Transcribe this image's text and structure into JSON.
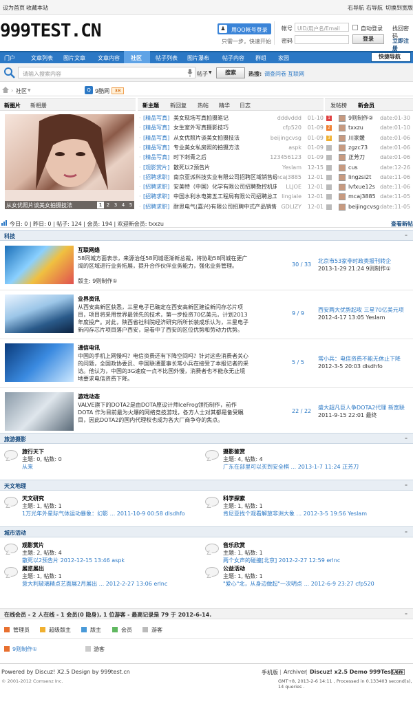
{
  "topbar": {
    "set_home": "设为首页",
    "bookmark": "收藏本站",
    "right_nav": "右导航",
    "right_nav2": "右导航",
    "wide_switch": "切换到宽版"
  },
  "logo": "999TEST.CN",
  "login": {
    "qq_button": "用QQ帐号登录",
    "qq_sub": "只需一步，快速开始",
    "account_label": "帐号",
    "account_placeholder": "UID/用户名/Email",
    "auto_login": "自动登录",
    "find_password": "找回密码",
    "password_label": "密码",
    "login_button": "登录",
    "register": "立即注册"
  },
  "nav": {
    "items": [
      "门户",
      "文章列表",
      "图片文章",
      "文章内容",
      "社区",
      "帖子列表",
      "图片瀑布",
      "帖子内容",
      "群组",
      "家园"
    ],
    "active": "社区",
    "quick_nav": "快捷导航"
  },
  "search": {
    "placeholder": "请输入搜索内容",
    "type": "帖子",
    "button": "搜索",
    "hot_label": "热搜:",
    "hot": [
      "调查问卷",
      "互联网"
    ]
  },
  "breadcrumb": {
    "home_icon": "home-icon",
    "community": "社区",
    "site": "9酷网",
    "count": "38"
  },
  "tabs_left": [
    "新图片",
    "新相册"
  ],
  "image_caption": "从女优照片谈美女拍摄技法",
  "image_pages": [
    "1",
    "2",
    "3",
    "4",
    "5"
  ],
  "tabs_mid": [
    "新主题",
    "新回复",
    "热帖",
    "精华",
    "日志"
  ],
  "tabs_right": [
    "发帖榜",
    "新会员"
  ],
  "threads": [
    {
      "cat": "[精品写真]",
      "title": "美女现场写真拍摄笔记",
      "author": "dddvddd",
      "date": "01-10"
    },
    {
      "cat": "[精品写真]",
      "title": "女生室外写真摄影技巧",
      "author": "cfp520",
      "date": "01-09"
    },
    {
      "cat": "[精品写真]",
      "title": "从女优照片谈美女拍摄技法",
      "author": "beijingcvsg",
      "date": "01-09"
    },
    {
      "cat": "[精品写真]",
      "title": "专业美女私房照的拍摄方法",
      "author": "aspk",
      "date": "01-09"
    },
    {
      "cat": "[精品写真]",
      "title": "时下刺青之后",
      "author": "123456123",
      "date": "01-09"
    },
    {
      "cat": "[观影赏片]",
      "title": "散死以2预告片",
      "author": "Yeslam",
      "date": "12-15"
    },
    {
      "cat": "[招聘求职]",
      "title": "南京亚派科技实业有限公司招聘区域销售经理",
      "author": "mcaj3885",
      "date": "12-01"
    },
    {
      "cat": "[招聘求职]",
      "title": "安美特（中国）化学有限公司招聘数控机床操",
      "author": "LLJOE",
      "date": "12-01"
    },
    {
      "cat": "[招聘求职]",
      "title": "中国水利水电第五工程局有限公司招聘总工程",
      "author": "lingiale",
      "date": "12-01"
    },
    {
      "cat": "[招聘求职]",
      "title": "耐思电气(嘉兴)有限公司招聘中式产品销售代",
      "author": "GDLIZY",
      "date": "12-01"
    }
  ],
  "members": [
    {
      "rank": "1",
      "name": "9则制作②",
      "date": "date:01-30"
    },
    {
      "rank": "2",
      "name": "txxzu",
      "date": "date:01-10"
    },
    {
      "rank": "3",
      "name": "川家媛",
      "date": "date:01-06"
    },
    {
      "rank": "",
      "name": "zgzc73",
      "date": "date:01-06"
    },
    {
      "rank": "",
      "name": "正芳刀",
      "date": "date:01-06"
    },
    {
      "rank": "",
      "name": "cus",
      "date": "date:12-26"
    },
    {
      "rank": "",
      "name": "lingzsi2t",
      "date": "date:11-06"
    },
    {
      "rank": "",
      "name": "lvfxue12s",
      "date": "date:11-06"
    },
    {
      "rank": "",
      "name": "mcaj3885",
      "date": "date:11-05"
    },
    {
      "rank": "",
      "name": "beijingcvsg",
      "date": "date:11-05"
    }
  ],
  "stats": {
    "text": "今日: 0  |  昨日: 0  |  帖子: 124  |  会员: 194  |  欢迎新会员: txxzu",
    "new_posts": "查看新帖"
  },
  "sections": [
    {
      "title": "科技",
      "forums": [
        {
          "name": "互联网络",
          "desc": "58同城方面表示，来源治任58同城逐渐新总裁，将协助58同城在更广阔的区域进行业务拓展，提升合作伙伴业务能力，强化业务管理。",
          "mods": "版主: 9则制作①",
          "count": "30 / 33",
          "last": "北京市53家非时政类报刊转企",
          "last_by": "2013-1-29 21:24  9则制作①"
        },
        {
          "name": "业界资讯",
          "desc": "从西安高新区获悉，三星电子已确定在西安高新区建设新闪存芯片项目，项目将采用世界最领先的技术，第一步投资70亿美元，计划2013年度投产。对此，陕西省社科院经济研究所所长装成乐认为，三星电子新闪存芯片项目落户西安，是看中了西安的区位优势和劳动力优势。",
          "mods": "",
          "count": "9 / 9",
          "last": "西安两大优势起攻 三星70亿美元项",
          "last_by": "2012-4-17 13:05  Yeslam"
        },
        {
          "name": "通信电讯",
          "desc": "中国的手机上网慢吗？电信资费还有下降空间吗？针对这些消费者关心的问题，全国政协委员、中国联通董事长常小兵在接受了本报记者的采访。他认为，中国的3G速度一点不比国外慢，消费者也不能永无止境地要求电信资费下降。",
          "mods": "",
          "count": "5 / 5",
          "last": "常小兵：电信资费不能无休止下降",
          "last_by": "2012-3-5 20:03  dlsdhfo"
        },
        {
          "name": "游戏动态",
          "desc": "VALVE旗下的DOTA2是由DOTA原设计师IceFrog领衔制作，前作 DOTA 作为目前最为火爆的网络竞技游戏，各方人士对其都是备受瞩目，因此DOTA2的国内代理权也成为各大厂商争夺的焦点。",
          "mods": "",
          "count": "22 / 22",
          "last": "盛大超凡巨人争DOTA2代理 新宽联",
          "last_by": "2011-9-15 22:01  最终"
        }
      ]
    },
    {
      "title": "旅游摄影",
      "forums": [
        {
          "name": "旅行天下",
          "stats": "主题: 0, 帖数: 0",
          "last": "从来"
        },
        {
          "name": "摄影鉴赏",
          "stats": "主题: 4, 帖数: 4",
          "last": "广东在部里可以买到安全棋 ... 2013-1-7 11:24 正芳刀"
        }
      ]
    },
    {
      "title": "天文地理",
      "forums": [
        {
          "name": "天文研究",
          "stats": "主题: 1, 帖数: 1",
          "last": "1万光年外星际气体运动暴象：幻影 ... 2011-10-9 00:58 dlsdhfo"
        },
        {
          "name": "科学探索",
          "stats": "主题: 1, 帖数: 1",
          "last": "肯尼亚找个观看解放非洲大象 ... 2012-3-5 19:56 Yeslam"
        }
      ]
    },
    {
      "title": "城市活动",
      "forums": [
        {
          "name": "观影赏片",
          "stats": "主题: 2, 帖数: 4",
          "last": "散死以2预告片 2012-12-15 13:46 aspk"
        },
        {
          "name": "音乐欣赏",
          "stats": "主题: 1, 帖数: 1",
          "last": "两个女声的碰撞[北京] 2012-2-27 12:59 erlnc"
        },
        {
          "name": "展览展出",
          "stats": "主题: 1, 帖数: 1",
          "last": "意大利玻璃精点艺面展2月展出 ... 2012-2-27 13:06 erlnc"
        },
        {
          "name": "公益活动",
          "stats": "主题: 1, 帖数: 1",
          "last": "\"爱心\"北，从身边做起\"一次明点 ... 2012-6-9 23:27 cfp520"
        }
      ]
    }
  ],
  "online": {
    "title": "在线会员 - 2 人在线 - 1 会员(0 隐身), 1 位游客 - 最高记录是 79 于 2012-6-14.",
    "legend": [
      "管理员",
      "超级版主",
      "版主",
      "会员",
      "游客"
    ],
    "users": [
      "9则制作①",
      "游客"
    ]
  },
  "footer": {
    "powered": "Powered by Discuz! X2.5 Design by 999test.cn",
    "copy": "© 2001-2012 Comsenz Inc.",
    "links": [
      "手机版",
      "Archiver",
      "Discuz! x2.5 Demo 999Test.cn"
    ],
    "chinaz": "CNZZ",
    "gmt": "GMT+8, 2013-2-6 14:11 , Processed in 0.133403 second(s), 14 queries ."
  },
  "colors": {
    "nav": "#2b78c5",
    "link": "#2b78c5",
    "section_bg": "#e8eef4"
  }
}
